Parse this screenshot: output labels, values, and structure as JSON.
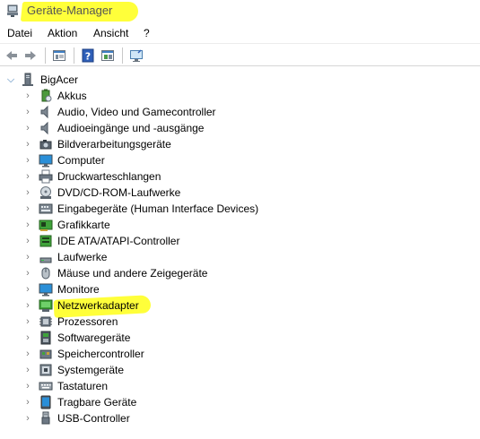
{
  "window": {
    "title": "Geräte-Manager",
    "title_highlight_color": "#ffff3a"
  },
  "menu": {
    "items": [
      "Datei",
      "Aktion",
      "Ansicht",
      "?"
    ]
  },
  "toolbar": {
    "buttons": [
      "back-arrow-icon",
      "forward-arrow-icon",
      "properties-icon",
      "help-icon",
      "toggle-view-icon",
      "scan-hardware-icon"
    ]
  },
  "tree": {
    "root": {
      "label": "BigAcer",
      "icon": "computer-tower-icon"
    },
    "items": [
      {
        "label": "Akkus",
        "icon": "battery-icon"
      },
      {
        "label": "Audio, Video und Gamecontroller",
        "icon": "speaker-icon"
      },
      {
        "label": "Audioeingänge und -ausgänge",
        "icon": "speaker-icon"
      },
      {
        "label": "Bildverarbeitungsgeräte",
        "icon": "camera-icon"
      },
      {
        "label": "Computer",
        "icon": "monitor-icon"
      },
      {
        "label": "Druckwarteschlangen",
        "icon": "printer-icon"
      },
      {
        "label": "DVD/CD-ROM-Laufwerke",
        "icon": "disc-drive-icon"
      },
      {
        "label": "Eingabegeräte (Human Interface Devices)",
        "icon": "hid-icon"
      },
      {
        "label": "Grafikkarte",
        "icon": "display-adapter-icon"
      },
      {
        "label": "IDE ATA/ATAPI-Controller",
        "icon": "ide-controller-icon"
      },
      {
        "label": "Laufwerke",
        "icon": "disk-drive-icon"
      },
      {
        "label": "Mäuse und andere Zeigegeräte",
        "icon": "mouse-icon"
      },
      {
        "label": "Monitore",
        "icon": "monitor-icon"
      },
      {
        "label": "Netzwerkadapter",
        "icon": "network-adapter-icon"
      },
      {
        "label": "Prozessoren",
        "icon": "processor-icon"
      },
      {
        "label": "Softwaregeräte",
        "icon": "software-device-icon"
      },
      {
        "label": "Speichercontroller",
        "icon": "storage-controller-icon"
      },
      {
        "label": "Systemgeräte",
        "icon": "system-device-icon"
      },
      {
        "label": "Tastaturen",
        "icon": "keyboard-icon"
      },
      {
        "label": "Tragbare Geräte",
        "icon": "portable-device-icon"
      },
      {
        "label": "USB-Controller",
        "icon": "usb-icon"
      }
    ],
    "highlighted_item": "Netzwerkadapter"
  }
}
